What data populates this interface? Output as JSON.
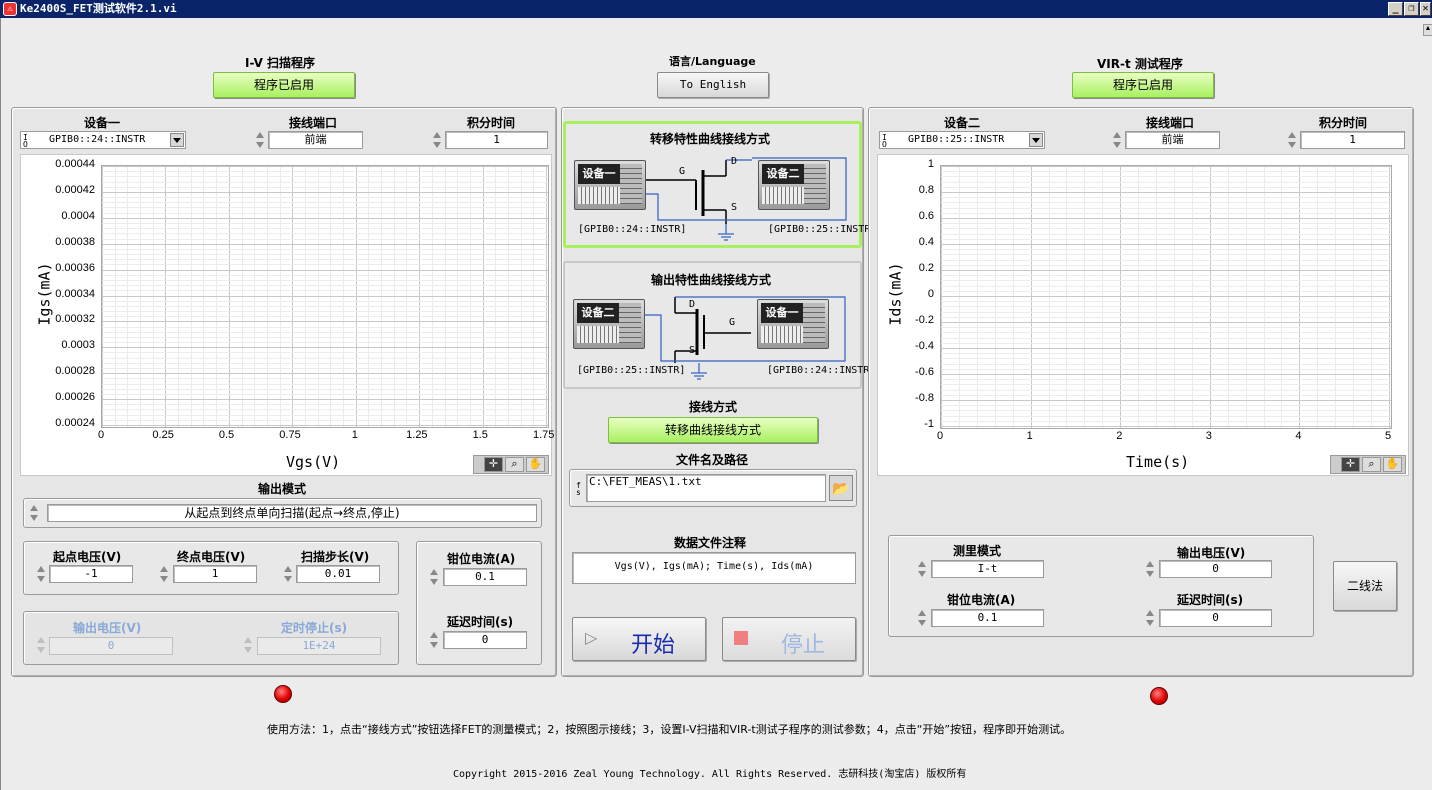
{
  "window": {
    "title": "Ke2400S_FET测试软件2.1.vi",
    "minimize": "_",
    "restore": "❐",
    "close": "✕"
  },
  "language": {
    "label": "语言/Language",
    "button": "To English"
  },
  "iv": {
    "heading": "I-V 扫描程序",
    "status": "程序已启用",
    "device_label": "设备一",
    "device_value": "GPIB0::24::INSTR",
    "terminal_label": "接线端口",
    "terminal_value": "前端",
    "integration_label": "积分时间",
    "integration_value": "1",
    "output_mode_label": "输出模式",
    "output_mode_value": "从起点到终点单向扫描(起点→终点,停止)",
    "start_v_label": "起点电压(V)",
    "start_v_value": "-1",
    "end_v_label": "终点电压(V)",
    "end_v_value": "1",
    "step_label": "扫描步长(V)",
    "step_value": "0.01",
    "clamp_label": "钳位电流(A)",
    "clamp_value": "0.1",
    "delay_label": "延迟时间(s)",
    "delay_value": "0",
    "out_v_label": "输出电压(V)",
    "out_v_value": "0",
    "timer_label": "定时停止(s)",
    "timer_value": "1E+24"
  },
  "virt": {
    "heading": "VIR-t 测试程序",
    "status": "程序已启用",
    "device_label": "设备二",
    "device_value": "GPIB0::25::INSTR",
    "terminal_label": "接线端口",
    "terminal_value": "前端",
    "integration_label": "积分时间",
    "integration_value": "1",
    "mode_label": "测里模式",
    "mode_value": "I-t",
    "out_v_label": "输出电压(V)",
    "out_v_value": "0",
    "clamp_label": "钳位电流(A)",
    "clamp_value": "0.1",
    "delay_label": "延迟时间(s)",
    "delay_value": "0",
    "two_wire": "二线法"
  },
  "center": {
    "transfer_title": "转移特性曲线接线方式",
    "output_title": "输出特性曲线接线方式",
    "dev1": "设备一",
    "dev2": "设备二",
    "gpib24": "[GPIB0::24::INSTR]",
    "gpib25": "[GPIB0::25::INSTR]",
    "pin_g": "G",
    "pin_d": "D",
    "pin_s": "S",
    "wiring_label": "接线方式",
    "wiring_value": "转移曲线接线方式",
    "file_label": "文件名及路径",
    "file_value": "C:\\FET_MEAS\\1.txt",
    "note_label": "数据文件注释",
    "note_value": "Vgs(V), Igs(mA); Time(s), Ids(mA)",
    "start": "开始",
    "stop": "停止"
  },
  "footer": {
    "usage": "使用方法：1，点击“接线方式”按钮选择FET的测量模式；2，按照图示接线；3，设置I-V扫描和VIR-t测试子程序的测试参数；4，点击“开始”按钮，程序即开始测试。",
    "copyright": "Copyright 2015-2016 Zeal Young Technology. All Rights Reserved. 志研科技(淘宝店) 版权所有"
  },
  "colors": {
    "active_green": "#a8f060",
    "led_red": "#e00000",
    "title_blue": "#0a246a"
  },
  "chart_data": [
    {
      "type": "line",
      "xlabel": "Vgs(V)",
      "ylabel": "Igs(mA)",
      "xlim": [
        0,
        1.75
      ],
      "ylim": [
        0.00024,
        0.00044
      ],
      "xticks": [
        "0",
        "0.25",
        "0.5",
        "0.75",
        "1",
        "1.25",
        "1.5",
        "1.75"
      ],
      "yticks": [
        "0.00044",
        "0.00042",
        "0.0004",
        "0.00038",
        "0.00036",
        "0.00034",
        "0.00032",
        "0.0003",
        "0.00028",
        "0.00026",
        "0.00024"
      ],
      "grid": true,
      "series": []
    },
    {
      "type": "line",
      "xlabel": "Time(s)",
      "ylabel": "Ids(mA)",
      "xlim": [
        0,
        5
      ],
      "ylim": [
        -1,
        1
      ],
      "xticks": [
        "0",
        "1",
        "2",
        "3",
        "4",
        "5"
      ],
      "yticks": [
        "1",
        "0.8",
        "0.6",
        "0.4",
        "0.2",
        "0",
        "-0.2",
        "-0.4",
        "-0.6",
        "-0.8",
        "-1"
      ],
      "grid": true,
      "series": []
    }
  ]
}
